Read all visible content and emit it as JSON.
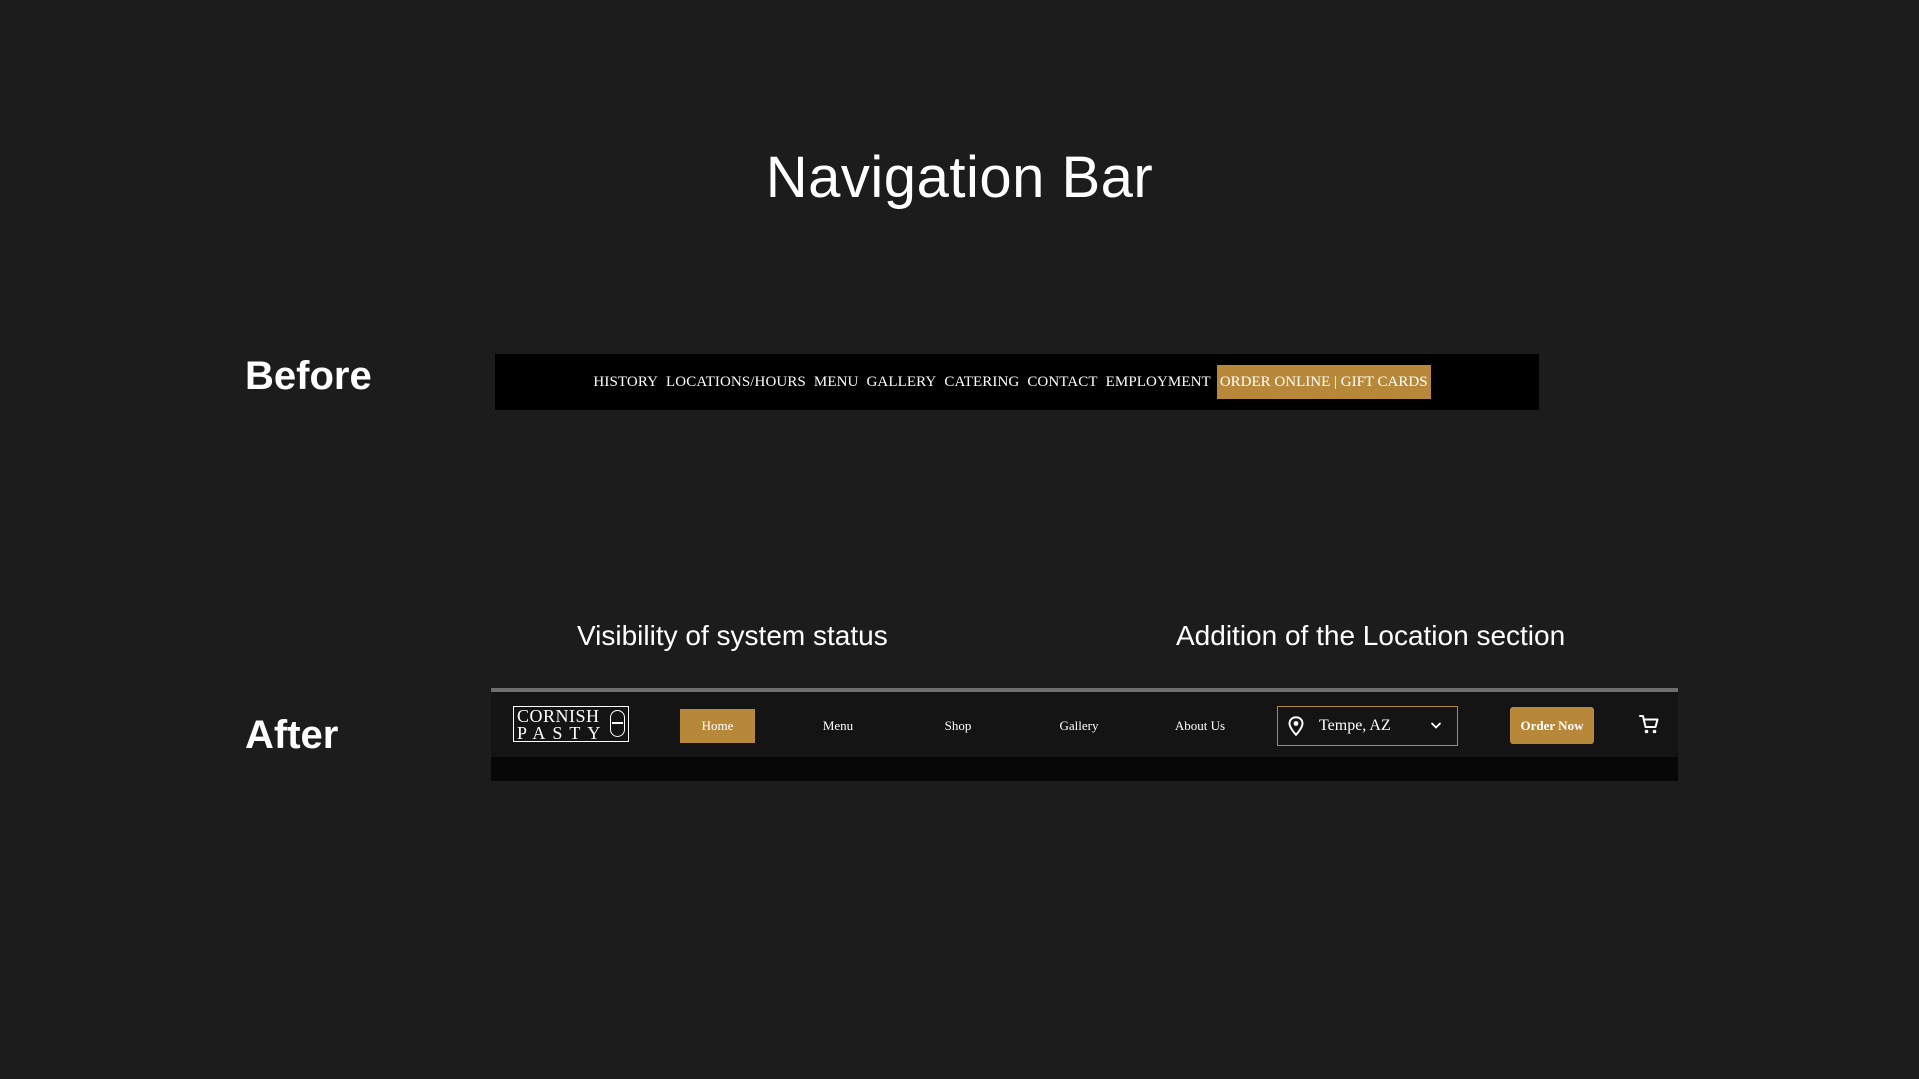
{
  "slide": {
    "title": "Navigation Bar",
    "before_label": "Before",
    "after_label": "After"
  },
  "before_nav": {
    "items": [
      "HISTORY",
      "LOCATIONS/HOURS",
      "MENU",
      "GALLERY",
      "CATERING",
      "CONTACT",
      "EMPLOYMENT"
    ],
    "cta": "ORDER ONLINE | GIFT CARDS"
  },
  "annotations": {
    "left": "Visibility of system status",
    "right": "Addition of the Location section"
  },
  "after_nav": {
    "logo": {
      "line1": "CORNISH",
      "line2": "PASTY"
    },
    "items": {
      "home": "Home",
      "menu": "Menu",
      "shop": "Shop",
      "gallery": "Gallery",
      "about": "About Us"
    },
    "location": {
      "value": "Tempe, AZ",
      "icon": "map-pin-icon"
    },
    "order_button": "Order Now",
    "cart_icon": "shopping-cart-icon"
  },
  "colors": {
    "background": "#1c1c1c",
    "accent": "#b8883a",
    "nav_black": "#000000"
  }
}
